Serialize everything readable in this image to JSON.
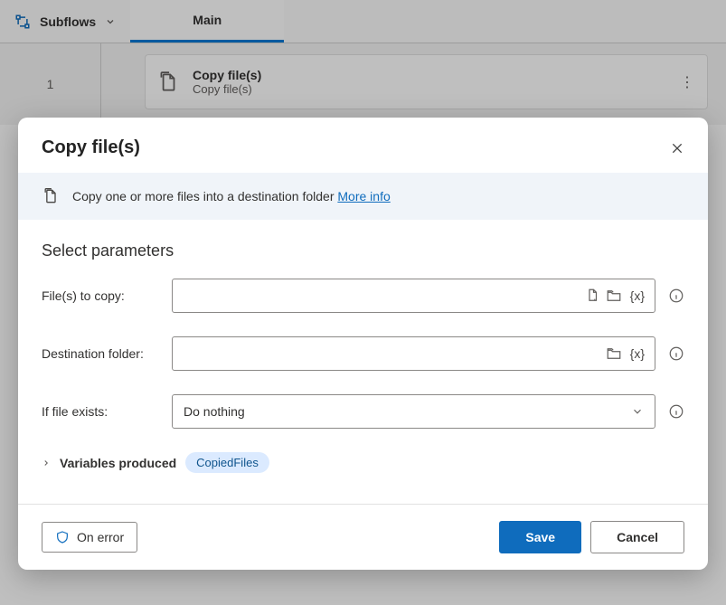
{
  "toolbar": {
    "subflows_label": "Subflows",
    "active_tab": "Main"
  },
  "canvas": {
    "step_number": "1",
    "action_title": "Copy file(s)",
    "action_subtitle": "Copy file(s)"
  },
  "dialog": {
    "title": "Copy file(s)",
    "banner_text": "Copy one or more files into a destination folder ",
    "more_info": "More info",
    "section_title": "Select parameters",
    "fields": {
      "files_to_copy": {
        "label": "File(s) to copy:",
        "value": ""
      },
      "destination": {
        "label": "Destination folder:",
        "value": ""
      },
      "if_exists": {
        "label": "If file exists:",
        "value": "Do nothing"
      }
    },
    "variables_label": "Variables produced",
    "variable_chip": "CopiedFiles",
    "on_error": "On error",
    "save": "Save",
    "cancel": "Cancel",
    "var_token": "{x}"
  }
}
